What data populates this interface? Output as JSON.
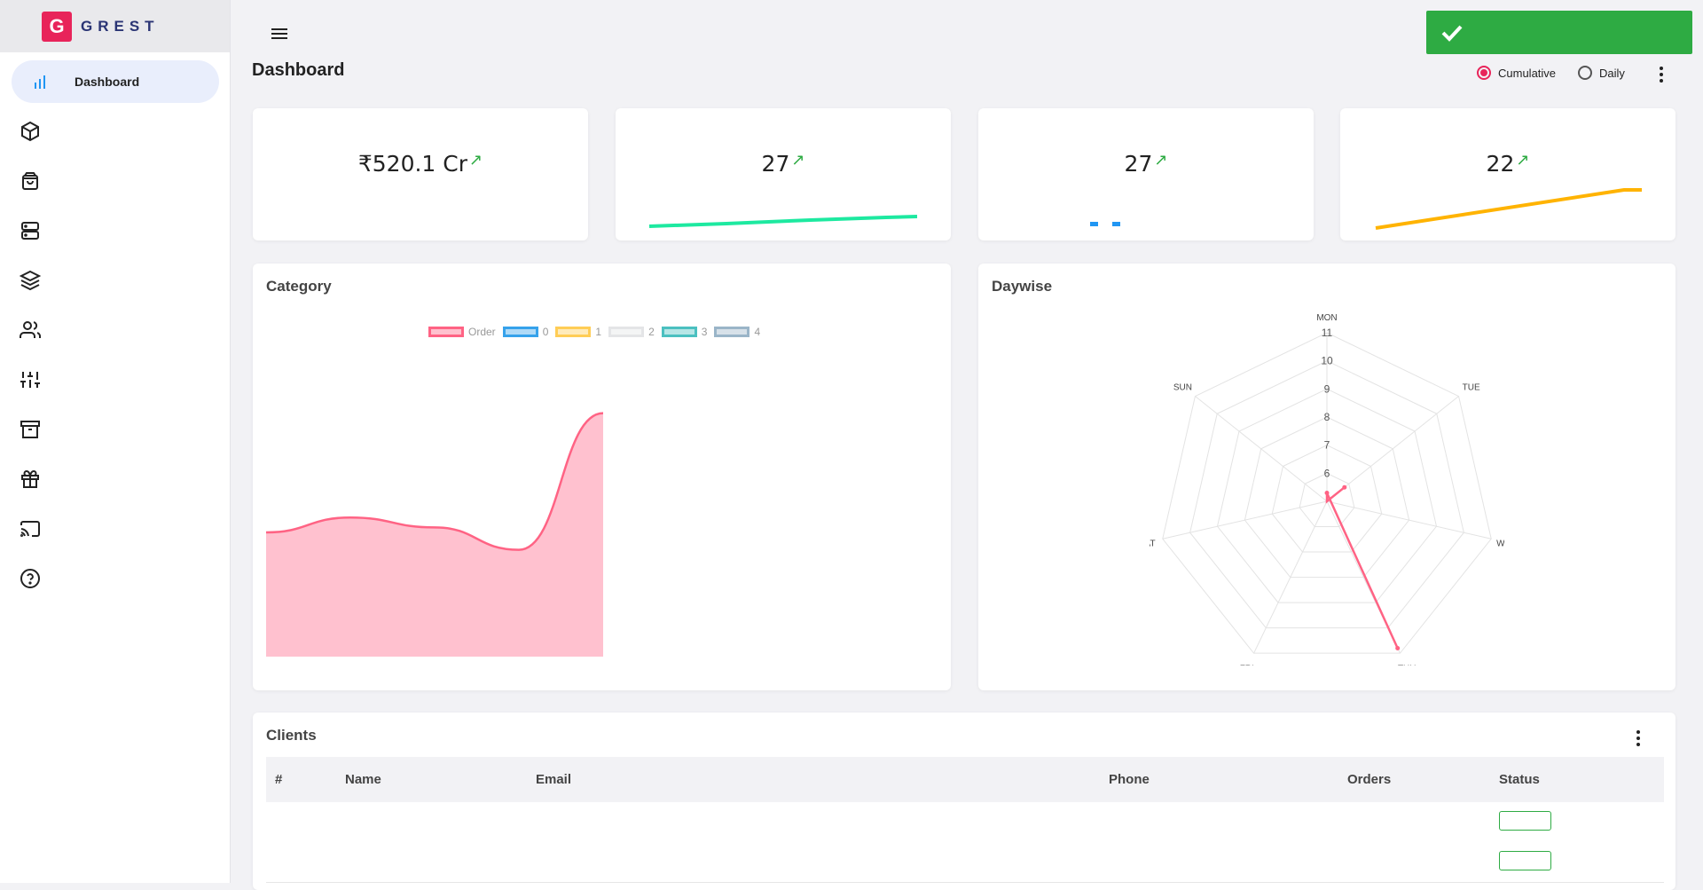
{
  "brand": {
    "logo_letter": "G",
    "name": "GREST"
  },
  "nav": {
    "active_label": "Dashboard",
    "items": [
      "chart-bars-icon",
      "box-icon",
      "shopping-bag-icon",
      "server-icon",
      "layers-icon",
      "users-icon",
      "sliders-icon",
      "archive-icon",
      "gift-icon",
      "cast-icon",
      "help-icon"
    ]
  },
  "page": {
    "title": "Dashboard"
  },
  "toast": {
    "icon": "check-icon",
    "color": "#2eab43"
  },
  "mode": {
    "options": [
      "Cumulative",
      "Daily"
    ],
    "selected": "Cumulative"
  },
  "stats": [
    {
      "value": "₹520.1 Cr",
      "trend_icon": "trending-up-icon"
    },
    {
      "value": "27",
      "trend_icon": "trending-up-icon",
      "spark_color": "#1de9a0"
    },
    {
      "value": "27",
      "trend_icon": "trending-up-icon",
      "spark_color": "#2196f3"
    },
    {
      "value": "22",
      "trend_icon": "trending-up-icon",
      "spark_color": "#ffb300"
    }
  ],
  "category": {
    "title": "Category",
    "legend": [
      {
        "label": "Order",
        "color": "#ff6384"
      },
      {
        "label": "0",
        "color": "#36a2eb"
      },
      {
        "label": "1",
        "color": "#ffcd56"
      },
      {
        "label": "2",
        "color": "#e4e5e7"
      },
      {
        "label": "3",
        "color": "#4bc0c0"
      },
      {
        "label": "4",
        "color": "#9ab5c8"
      }
    ]
  },
  "daywise": {
    "title": "Daywise",
    "axes": [
      "MON",
      "TUE",
      "WED",
      "THU",
      "FRI",
      "SAT",
      "SUN"
    ],
    "ticks": [
      "6",
      "7",
      "8",
      "9",
      "10",
      "11"
    ]
  },
  "chart_data": [
    {
      "type": "area",
      "title": "Category",
      "series": [
        {
          "name": "Order",
          "values": [
            5.0,
            5.6,
            5.2,
            4.3,
            9.8
          ]
        }
      ],
      "legend": [
        "Order",
        "0",
        "1",
        "2",
        "3",
        "4"
      ]
    },
    {
      "type": "radar",
      "title": "Daywise",
      "categories": [
        "MON",
        "TUE",
        "WED",
        "THU",
        "FRI",
        "SAT",
        "SUN"
      ],
      "r_ticks": [
        6,
        7,
        8,
        9,
        10,
        11
      ],
      "series": [
        {
          "values": [
            5.3,
            5.8,
            null,
            10.8,
            null,
            null,
            null
          ]
        }
      ]
    }
  ],
  "clients": {
    "title": "Clients",
    "columns": [
      "#",
      "Name",
      "Email",
      "Phone",
      "Orders",
      "Status"
    ],
    "rows": [
      {
        "status_color": "#2eab43"
      },
      {
        "status_color": "#2eab43"
      }
    ]
  }
}
